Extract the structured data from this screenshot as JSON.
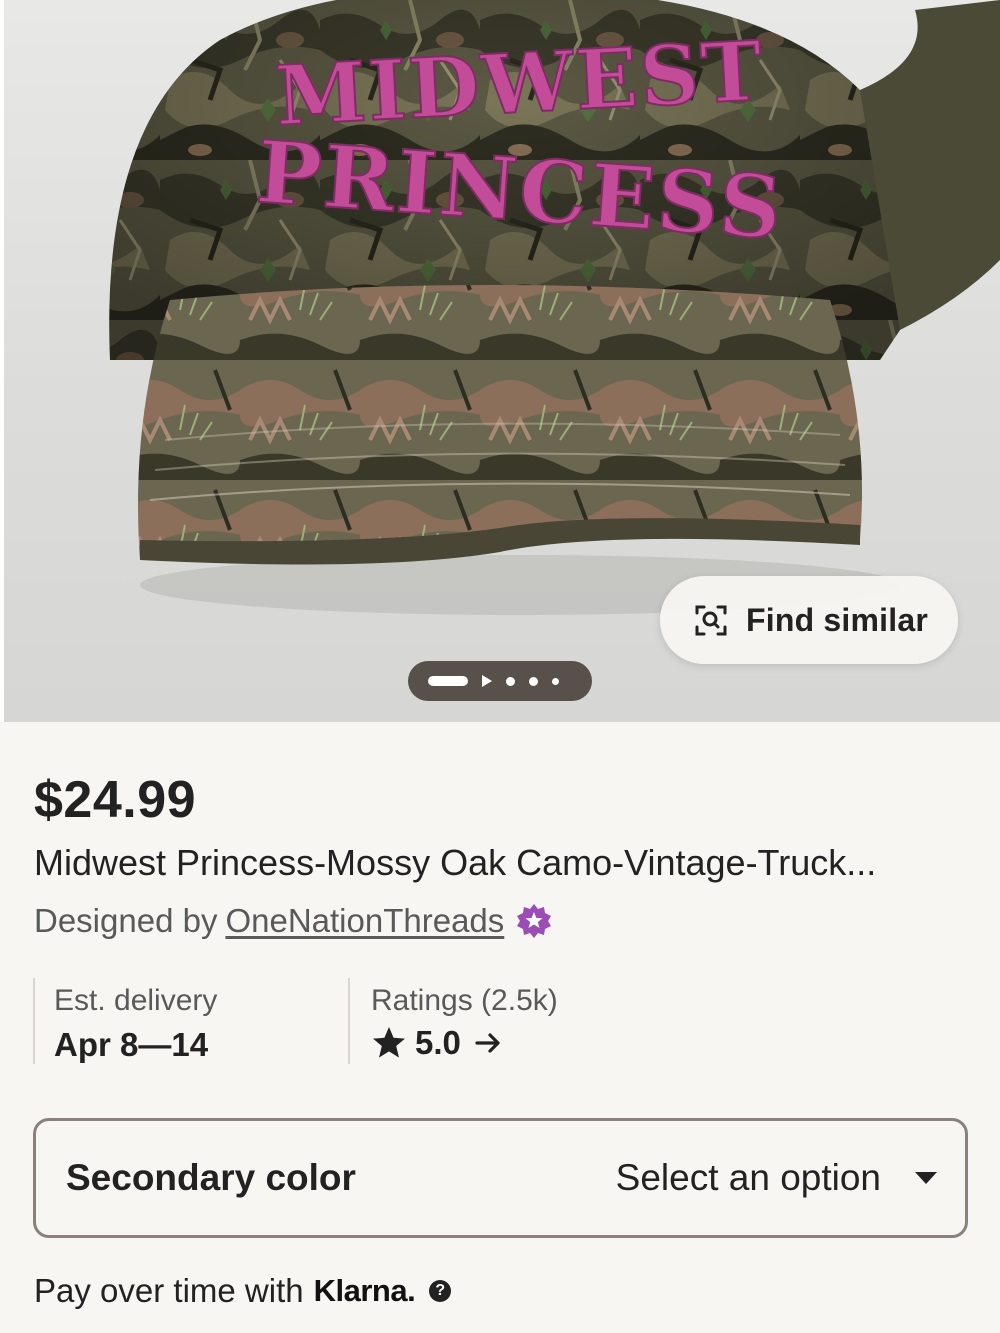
{
  "hero": {
    "image_alt": "Camouflage baseball cap with pink embroidered text",
    "cap_text_line1": "MIDWEST",
    "cap_text_line2": "PRINCESS",
    "find_similar_label": "Find similar",
    "find_similar_icon": "image-search-icon",
    "pager_icon": "play-icon"
  },
  "listing": {
    "price": "$24.99",
    "title": "Midwest Princess-Mossy Oak Camo-Vintage-Truck...",
    "designed_by_prefix": "Designed by",
    "shop_name": "OneNationThreads",
    "shop_badge_icon": "star-seller-icon",
    "delivery": {
      "label": "Est. delivery",
      "value": "Apr 8—14"
    },
    "ratings": {
      "label": "Ratings (2.5k)",
      "value": "5.0",
      "star_icon": "star-icon",
      "arrow_icon": "arrow-right-icon"
    }
  },
  "variation": {
    "label": "Secondary color",
    "placeholder": "Select an option",
    "icon": "caret-down-icon"
  },
  "payment": {
    "text": "Pay over time with",
    "provider": "Klarna.",
    "help_icon": "question-icon"
  },
  "colors": {
    "embroidery_pink": "#c24c98",
    "badge_purple": "#9b4db5",
    "background": "#f8f6f2",
    "text": "#222222",
    "muted_text": "#595959",
    "border": "#8a817c"
  }
}
